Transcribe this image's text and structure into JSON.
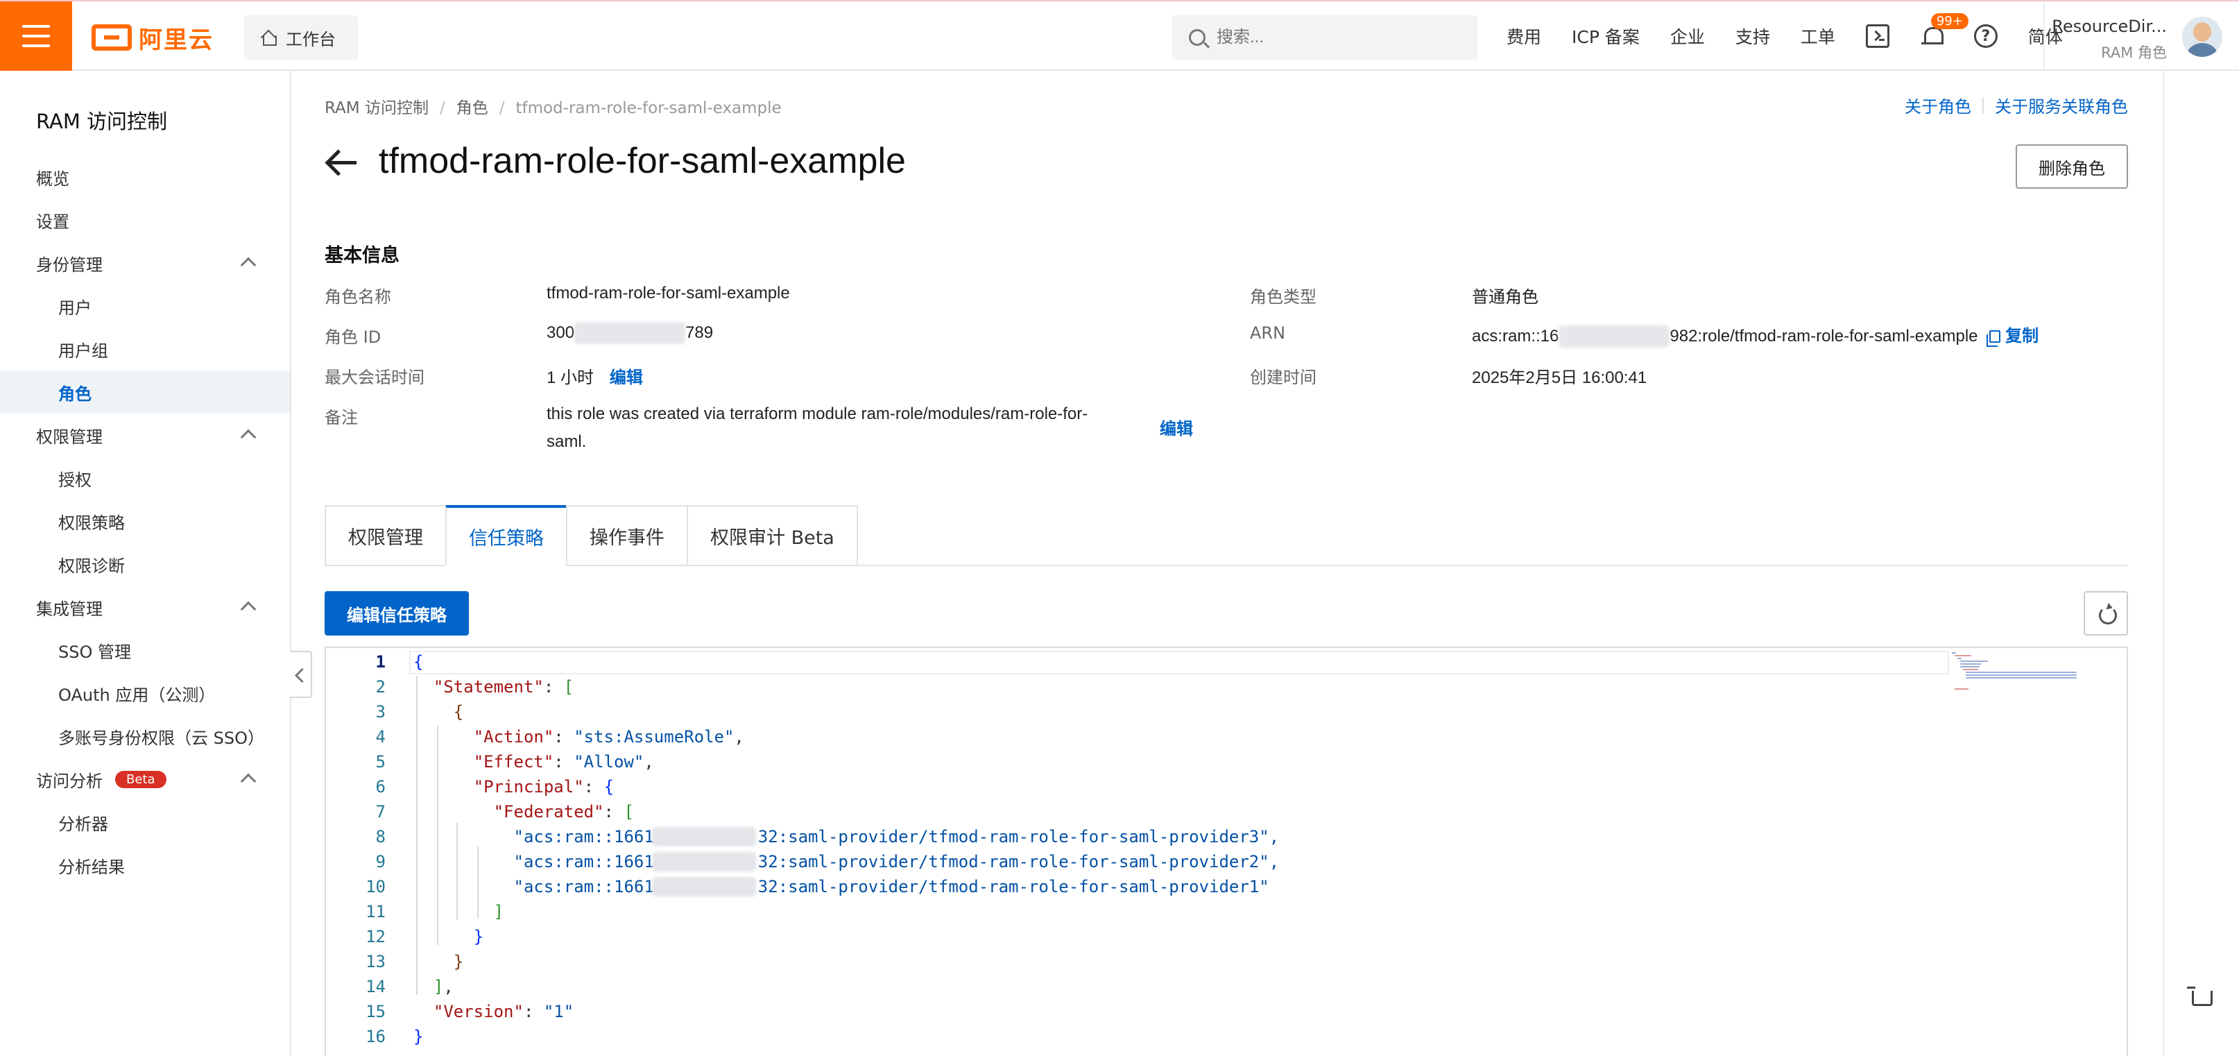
{
  "topbar": {
    "logo_text": "阿里云",
    "workbench_label": "工作台",
    "search_placeholder": "搜索...",
    "links": [
      "费用",
      "ICP 备案",
      "企业",
      "支持",
      "工单"
    ],
    "notification_badge": "99+",
    "language": "简体",
    "account_name": "ResourceDir...",
    "account_role": "RAM 角色",
    "accent_color": "#ff6a00"
  },
  "sidebar": {
    "title": "RAM 访问控制",
    "items": [
      {
        "label": "概览",
        "level": 1
      },
      {
        "label": "设置",
        "level": 1
      },
      {
        "label": "身份管理",
        "level": 1,
        "expanded": true
      },
      {
        "label": "用户",
        "level": 2
      },
      {
        "label": "用户组",
        "level": 2
      },
      {
        "label": "角色",
        "level": 2,
        "active": true
      },
      {
        "label": "权限管理",
        "level": 1,
        "expanded": true
      },
      {
        "label": "授权",
        "level": 2
      },
      {
        "label": "权限策略",
        "level": 2
      },
      {
        "label": "权限诊断",
        "level": 2
      },
      {
        "label": "集成管理",
        "level": 1,
        "expanded": true
      },
      {
        "label": "SSO 管理",
        "level": 2
      },
      {
        "label": "OAuth 应用（公测）",
        "level": 2
      },
      {
        "label": "多账号身份权限（云 SSO）",
        "level": 2
      },
      {
        "label": "访问分析",
        "level": 1,
        "expanded": true,
        "badge": "Beta"
      },
      {
        "label": "分析器",
        "level": 2
      },
      {
        "label": "分析结果",
        "level": 2
      }
    ]
  },
  "breadcrumb": {
    "items": [
      "RAM 访问控制",
      "角色",
      "tfmod-ram-role-for-saml-example"
    ]
  },
  "header": {
    "title": "tfmod-ram-role-for-saml-example",
    "link_about_role": "关于角色",
    "link_about_service_role": "关于服务关联角色",
    "delete_button": "删除角色"
  },
  "basic_info": {
    "section_title": "基本信息",
    "role_name_label": "角色名称",
    "role_name": "tfmod-ram-role-for-saml-example",
    "role_id_label": "角色 ID",
    "role_id_prefix": "300",
    "role_id_suffix": "789",
    "session_label": "最大会话时间",
    "session_value": "1 小时",
    "edit_label": "编辑",
    "note_label": "备注",
    "note_line1": "this role was created via terraform module ram-role/modules/ram-role-for-",
    "note_line2": "saml.",
    "role_type_label": "角色类型",
    "role_type": "普通角色",
    "arn_label": "ARN",
    "arn_prefix": "acs:ram::16",
    "arn_suffix": "982:role/tfmod-ram-role-for-saml-example",
    "copy_label": "复制",
    "created_label": "创建时间",
    "created_value": "2025年2月5日 16:00:41"
  },
  "tabs": [
    {
      "label": "权限管理"
    },
    {
      "label": "信任策略",
      "active": true
    },
    {
      "label": "操作事件"
    },
    {
      "label": "权限审计 Beta"
    }
  ],
  "policy": {
    "edit_button": "编辑信任策略",
    "provider_prefix": "\"acs:ram::1661",
    "provider_suffixes": [
      "32:saml-provider/tfmod-ram-role-for-saml-provider3\",",
      "32:saml-provider/tfmod-ram-role-for-saml-provider2\",",
      "32:saml-provider/tfmod-ram-role-for-saml-provider1\""
    ],
    "line_numbers": [
      "1",
      "2",
      "3",
      "4",
      "5",
      "6",
      "7",
      "8",
      "9",
      "10",
      "11",
      "12",
      "13",
      "14",
      "15",
      "16"
    ],
    "keys": {
      "statement": "\"Statement\"",
      "action": "\"Action\"",
      "effect": "\"Effect\"",
      "principal": "\"Principal\"",
      "federated": "\"Federated\"",
      "version": "\"Version\""
    },
    "values": {
      "action": "\"sts:AssumeRole\"",
      "effect": "\"Allow\"",
      "version": "\"1\""
    }
  }
}
